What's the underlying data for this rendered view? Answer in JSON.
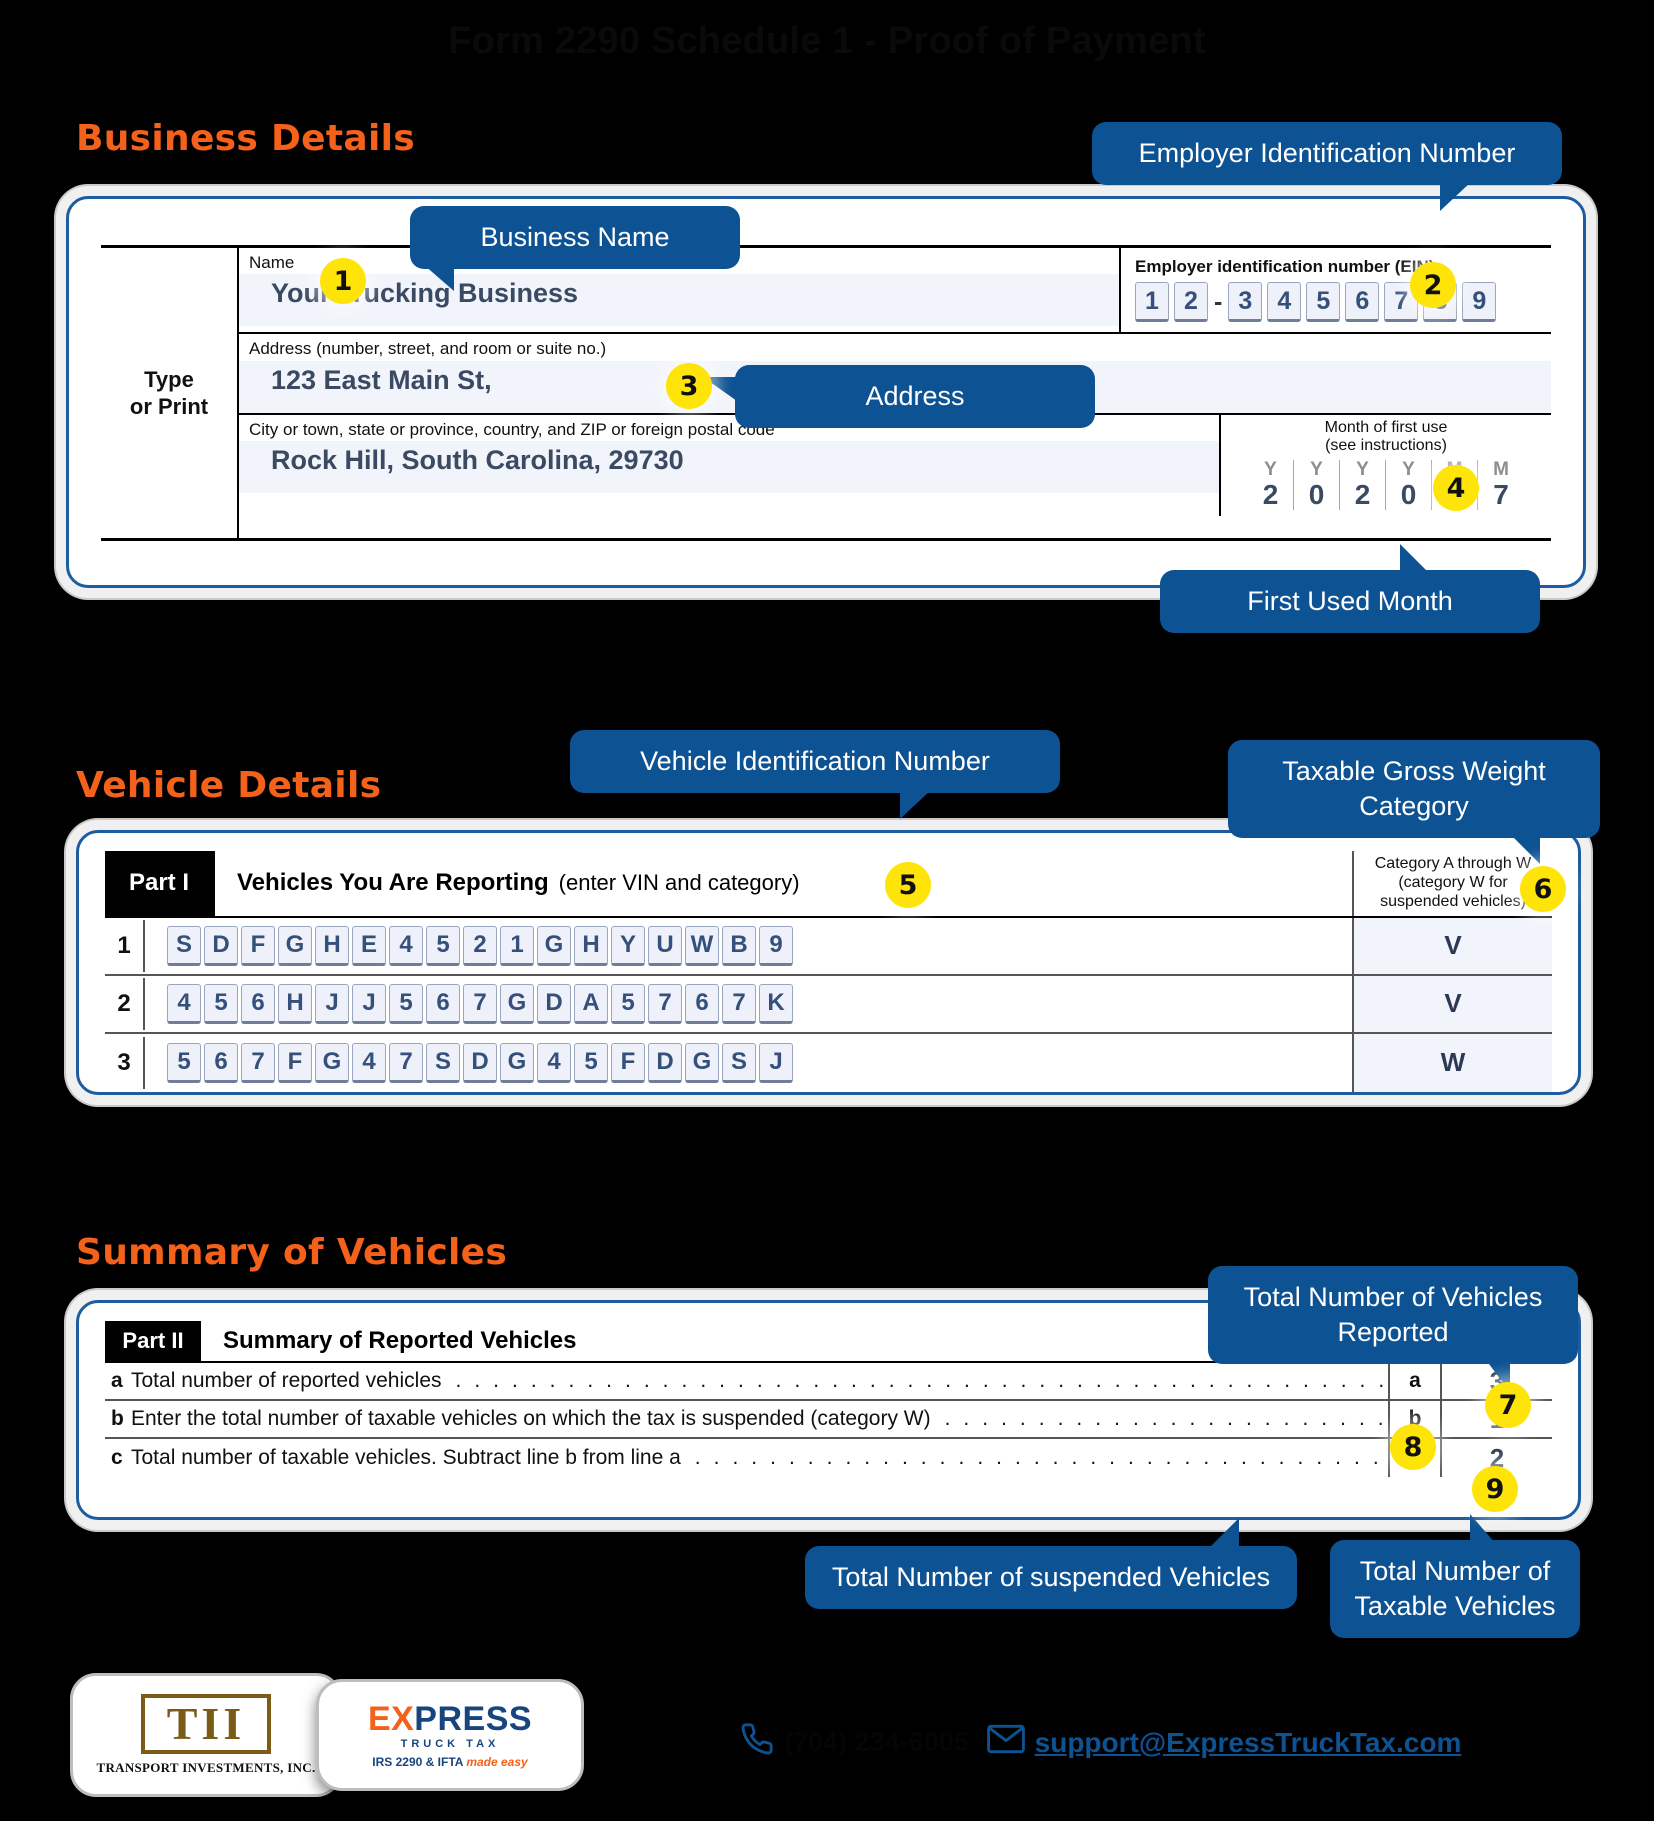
{
  "page": {
    "title": "Form 2290 Schedule 1 - Proof of Payment"
  },
  "sections": {
    "business": "Business Details",
    "vehicle": "Vehicle Details",
    "summary": "Summary of Vehicles"
  },
  "business_form": {
    "type_or_print": "Type\nor Print",
    "name_label": "Name",
    "name_value": "Your Trucking Business",
    "ein_label": "Employer identification number (EIN)",
    "ein_digits": [
      "1",
      "2",
      "-",
      "3",
      "4",
      "5",
      "6",
      "7",
      "8",
      "9"
    ],
    "address_label": "Address (number, street, and room or suite no.)",
    "address_value": "123 East Main St,",
    "city_label": "City or town, state or province, country, and ZIP or foreign postal code",
    "city_value": "Rock Hill, South Carolina, 29730",
    "mfu_label_line1": "Month of first use",
    "mfu_label_line2": "(see instructions)",
    "mfu_headers": [
      "Y",
      "Y",
      "Y",
      "Y",
      "M",
      "M"
    ],
    "mfu_digits": [
      "2",
      "0",
      "2",
      "0",
      "0",
      "7"
    ]
  },
  "vehicle_form": {
    "part_label": "Part I",
    "part_title": "Vehicles You Are Reporting",
    "part_subtitle": "(enter VIN and category)",
    "category_header": [
      "Category A through W",
      "(category W for",
      "suspended vehicles)"
    ],
    "rows": [
      {
        "num": "1",
        "vin": "SDFGHE4521GHYUWB9",
        "category": "V"
      },
      {
        "num": "2",
        "vin": "456HJJ567GDA5767K",
        "category": "V"
      },
      {
        "num": "3",
        "vin": "567FG47SDG45FDGSJ",
        "category": "W"
      }
    ]
  },
  "summary_form": {
    "part_label": "Part II",
    "part_title": "Summary of Reported Vehicles",
    "rows": [
      {
        "letter": "a",
        "text": "Total number of reported vehicles",
        "key": "a",
        "value": "3"
      },
      {
        "letter": "b",
        "text": "Enter the total number of taxable vehicles on which the tax is suspended (category W)",
        "key": "b",
        "value": "1"
      },
      {
        "letter": "c",
        "text": "Total number of taxable vehicles. Subtract line b from line a",
        "key": "c",
        "value": "2"
      }
    ]
  },
  "callouts": [
    {
      "id": 1,
      "badge": "1",
      "text": "Business Name"
    },
    {
      "id": 2,
      "badge": "2",
      "text": "Employer Identification Number"
    },
    {
      "id": 3,
      "badge": "3",
      "text": "Address"
    },
    {
      "id": 4,
      "badge": "4",
      "text": "First Used Month"
    },
    {
      "id": 5,
      "badge": "5",
      "text": "Vehicle Identification Number"
    },
    {
      "id": 6,
      "badge": "6",
      "text": "Taxable Gross Weight Category"
    },
    {
      "id": 7,
      "badge": "7",
      "text": "Total Number of Vehicles Reported"
    },
    {
      "id": 8,
      "badge": "8",
      "text": "Total Number of suspended Vehicles"
    },
    {
      "id": 9,
      "badge": "9",
      "text": "Total Number of Taxable Vehicles"
    }
  ],
  "footer": {
    "logo_tii_mark": "TII",
    "logo_tii_sub": "TRANSPORT INVESTMENTS, INC.",
    "logo_ett_top_ex": "EX",
    "logo_ett_top_rest": "PRESS",
    "logo_ett_mid": "TRUCK TAX",
    "logo_ett_bot_prefix": "IRS 2290 & IFTA ",
    "logo_ett_bot_italic": "made easy",
    "phone": "(704) 234-6005",
    "email": "support@ExpressTruckTax.com",
    "phone_icon": "phone-icon",
    "email_icon": "envelope-icon"
  },
  "colors": {
    "accent_orange": "#f4611a",
    "callout_blue": "#0d5292",
    "badge_yellow": "#ffe40a",
    "value_navy": "#3a4a63",
    "background": "#000000"
  }
}
